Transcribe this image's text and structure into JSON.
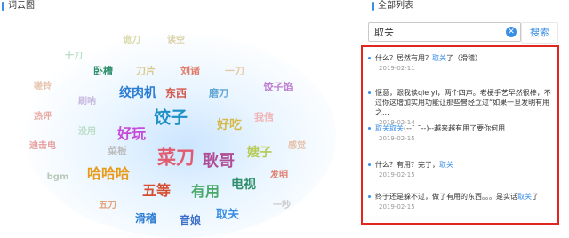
{
  "wordcloud_panel": {
    "title": "词云图"
  },
  "wordcloud": {
    "words": [
      {
        "text": "诡刀",
        "color": "#d9d9a9"
      },
      {
        "text": "读空",
        "color": "#dcd2a8"
      },
      {
        "text": "十刀",
        "color": "#b9ddc6"
      },
      {
        "text": "卧槽",
        "color": "#2f8f6b"
      },
      {
        "text": "刀片",
        "color": "#d9c98a"
      },
      {
        "text": "刘诸",
        "color": "#e07c6a"
      },
      {
        "text": "一刀",
        "color": "#e6c9a6"
      },
      {
        "text": "嗟铃",
        "color": "#e6c3ad"
      },
      {
        "text": "绞肉机",
        "color": "#2a7bd4"
      },
      {
        "text": "东西",
        "color": "#d6554a"
      },
      {
        "text": "磨刀",
        "color": "#62a8d6"
      },
      {
        "text": "饺子馅",
        "color": "#bc7bd0"
      },
      {
        "text": "刷呐",
        "color": "#c9b9e0"
      },
      {
        "text": "热评",
        "color": "#e8a8a2"
      },
      {
        "text": "饺子",
        "color": "#1c8fc7"
      },
      {
        "text": "我信",
        "color": "#f0b4b4"
      },
      {
        "text": "好玩",
        "color": "#c64ad9"
      },
      {
        "text": "好吃",
        "color": "#d7b94a"
      },
      {
        "text": "没用",
        "color": "#b9ddc6"
      },
      {
        "text": "迪击电",
        "color": "#e8a0a0"
      },
      {
        "text": "菜刀",
        "color": "#e15a6e"
      },
      {
        "text": "耿哥",
        "color": "#b14d96"
      },
      {
        "text": "嫂子",
        "color": "#b6c954"
      },
      {
        "text": "感觉",
        "color": "#e6c3ad"
      },
      {
        "text": "菜板",
        "color": "#bdbdbd"
      },
      {
        "text": "哈哈哈",
        "color": "#e89a1a"
      },
      {
        "text": "bgm",
        "color": "#b9c9b9"
      },
      {
        "text": "发明",
        "color": "#e07c6a"
      },
      {
        "text": "五等",
        "color": "#d64c2e"
      },
      {
        "text": "有用",
        "color": "#4aa86a"
      },
      {
        "text": "电视",
        "color": "#2f8f6b"
      },
      {
        "text": "一秒",
        "color": "#c9c9c9"
      },
      {
        "text": "五刀",
        "color": "#e6a37a"
      },
      {
        "text": "滑稽",
        "color": "#2a7bd4"
      },
      {
        "text": "音娘",
        "color": "#3a6ec7"
      },
      {
        "text": "取关",
        "color": "#3a8ee6"
      }
    ]
  },
  "list_panel": {
    "title": "全部列表"
  },
  "search": {
    "value": "取关",
    "placeholder": "",
    "button_label": "搜索"
  },
  "results": [
    {
      "pre": "什么？居然有用？",
      "hl": "取关",
      "post": "了（滑稽）",
      "date": "2019-02-11"
    },
    {
      "pre": "惬意，跟我读qie yi，两个四声。老梗手艺早然很棒，不过你这增加实用功能让那些曾经立过“如果一旦发明有用之...",
      "hl": "",
      "post": "",
      "date": "2019-02-14"
    },
    {
      "pre": "",
      "hl": "取关取关",
      "post": "(--¯ ¯--)--越来越有用了要你何用",
      "date": "2019-02-15"
    },
    {
      "pre": "什么？有用？完了，",
      "hl": "取关",
      "post": "",
      "date": "2019-02-15"
    },
    {
      "pre": "终于还是躲不过，做了有用的东西。。。是实话",
      "hl": "取关",
      "post": "了",
      "date": "2019-02-15"
    }
  ]
}
